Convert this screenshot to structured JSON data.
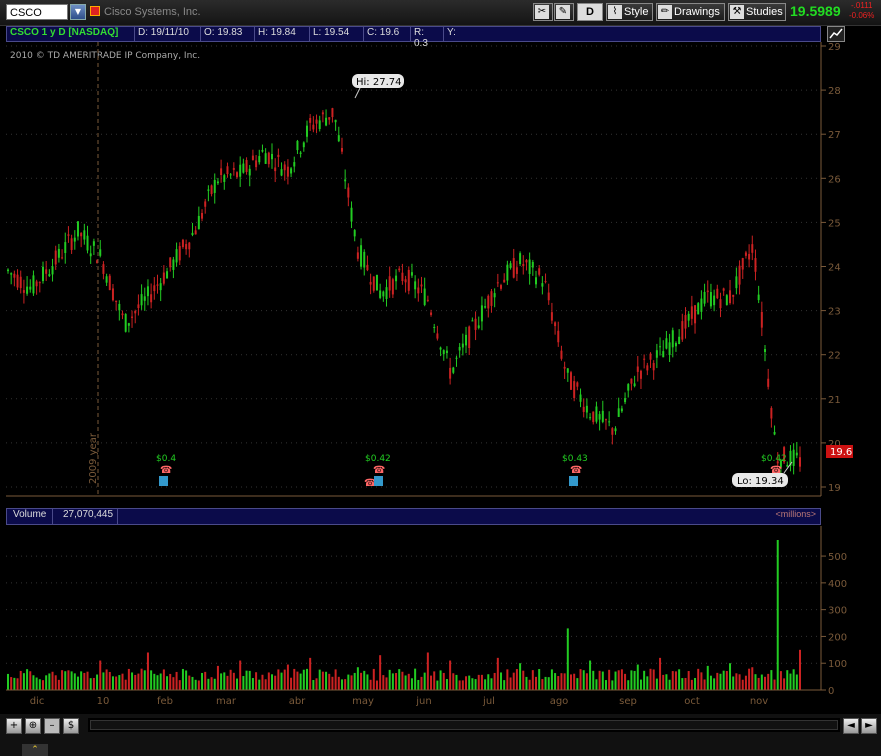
{
  "toolbar": {
    "symbol": "CSCO",
    "company": "Cisco Systems, Inc.",
    "period_button": "D",
    "style_label": "Style",
    "drawings_label": "Drawings",
    "studies_label": "Studies",
    "last_price": "19.5989",
    "net_change": "-.0111",
    "pct_change": "-0.06%"
  },
  "info_bar": {
    "study": "CSCO 1 y D [NASDAQ]",
    "date": "D: 19/11/10",
    "open": "O: 19.83",
    "high": "H: 19.84",
    "low": "L: 19.54",
    "close": "C: 19.6",
    "range": "R: 0.3",
    "y": "Y:"
  },
  "copyright": "2010 © TD AMERITRADE IP Company, Inc.",
  "price_chart": {
    "y_ticks": [
      "19",
      "20",
      "21",
      "22",
      "23",
      "24",
      "25",
      "26",
      "27",
      "28",
      "29"
    ],
    "hi_label": "Hi: 27.74",
    "lo_label": "Lo: 19.34",
    "last_bubble": "19.6",
    "year_marker": "2009 year",
    "dividends": [
      "$0.4",
      "$0.42",
      "$0.43",
      "$0.42"
    ]
  },
  "volume": {
    "label": "Volume",
    "value": "27,070,445",
    "units": "<millions>",
    "y_ticks": [
      "0",
      "100",
      "200",
      "300",
      "400",
      "500"
    ]
  },
  "x_axis": {
    "labels": [
      "dic",
      "10",
      "feb",
      "mar",
      "abr",
      "may",
      "jun",
      "jul",
      "ago",
      "sep",
      "oct",
      "nov"
    ]
  },
  "colors": {
    "up": "#22cc22",
    "down": "#cc2222",
    "axis": "#7a5a3a",
    "grid": "#333333",
    "panel": "#0b0b4a",
    "price": "#22dd22"
  },
  "chart_data": {
    "type": "candlestick",
    "title": "CSCO 1 y D [NASDAQ]",
    "ylim": [
      19,
      29
    ],
    "x_labels": [
      "dic",
      "10",
      "feb",
      "mar",
      "abr",
      "may",
      "jun",
      "jul",
      "ago",
      "sep",
      "oct",
      "nov"
    ],
    "series": [
      {
        "name": "CSCO",
        "unit": "price",
        "ohlc_approx": [
          [
            23.6,
            24.1,
            23.2,
            23.9
          ],
          [
            24.0,
            24.4,
            23.3,
            23.5
          ],
          [
            23.4,
            24.3,
            23.1,
            24.1
          ],
          [
            24.1,
            25.0,
            23.8,
            24.8
          ],
          [
            24.5,
            24.9,
            23.9,
            24.2
          ],
          [
            23.9,
            24.1,
            22.4,
            22.7
          ],
          [
            22.8,
            23.5,
            22.6,
            23.3
          ],
          [
            23.4,
            24.2,
            23.2,
            24.0
          ],
          [
            24.1,
            25.0,
            23.9,
            24.8
          ],
          [
            24.7,
            26.3,
            24.5,
            26.0
          ],
          [
            25.9,
            26.4,
            25.5,
            26.1
          ],
          [
            26.0,
            26.9,
            25.6,
            26.6
          ],
          [
            26.5,
            27.0,
            25.8,
            26.2
          ],
          [
            26.3,
            27.4,
            26.0,
            27.2
          ],
          [
            27.2,
            27.74,
            26.6,
            27.5
          ],
          [
            27.4,
            27.5,
            23.3,
            24.4
          ],
          [
            24.3,
            25.0,
            23.0,
            23.4
          ],
          [
            23.3,
            24.0,
            22.7,
            23.8
          ],
          [
            23.7,
            24.2,
            23.0,
            23.3
          ],
          [
            23.2,
            23.6,
            21.2,
            21.6
          ],
          [
            21.6,
            22.8,
            20.9,
            22.6
          ],
          [
            22.7,
            23.9,
            22.3,
            23.6
          ],
          [
            23.5,
            24.6,
            23.0,
            24.1
          ],
          [
            24.0,
            24.9,
            23.4,
            23.7
          ],
          [
            22.2,
            22.6,
            21.3,
            21.5
          ],
          [
            21.5,
            22.6,
            20.5,
            20.7
          ],
          [
            20.6,
            20.9,
            19.8,
            20.3
          ],
          [
            20.3,
            21.8,
            20.1,
            21.6
          ],
          [
            21.7,
            22.3,
            21.4,
            22.0
          ],
          [
            21.9,
            22.8,
            21.6,
            22.6
          ],
          [
            22.5,
            23.6,
            22.2,
            23.3
          ],
          [
            23.4,
            24.1,
            22.8,
            23.3
          ],
          [
            23.3,
            24.6,
            22.9,
            24.5
          ],
          [
            21.0,
            21.0,
            19.5,
            19.7
          ],
          [
            19.7,
            19.9,
            19.34,
            19.6
          ]
        ]
      },
      {
        "name": "Volume",
        "unit": "millions",
        "values_approx": [
          60,
          70,
          55,
          50,
          110,
          90,
          140,
          60,
          75,
          90,
          110,
          80,
          95,
          120,
          100,
          85,
          130,
          90,
          140,
          110,
          95,
          120,
          100,
          80,
          230,
          110,
          90,
          95,
          120,
          105,
          90,
          100,
          85,
          560,
          150
        ]
      }
    ],
    "annotations": {
      "high": 27.74,
      "low": 19.34,
      "last": 19.6
    },
    "dividends": [
      0.4,
      0.42,
      0.43,
      0.42
    ]
  }
}
